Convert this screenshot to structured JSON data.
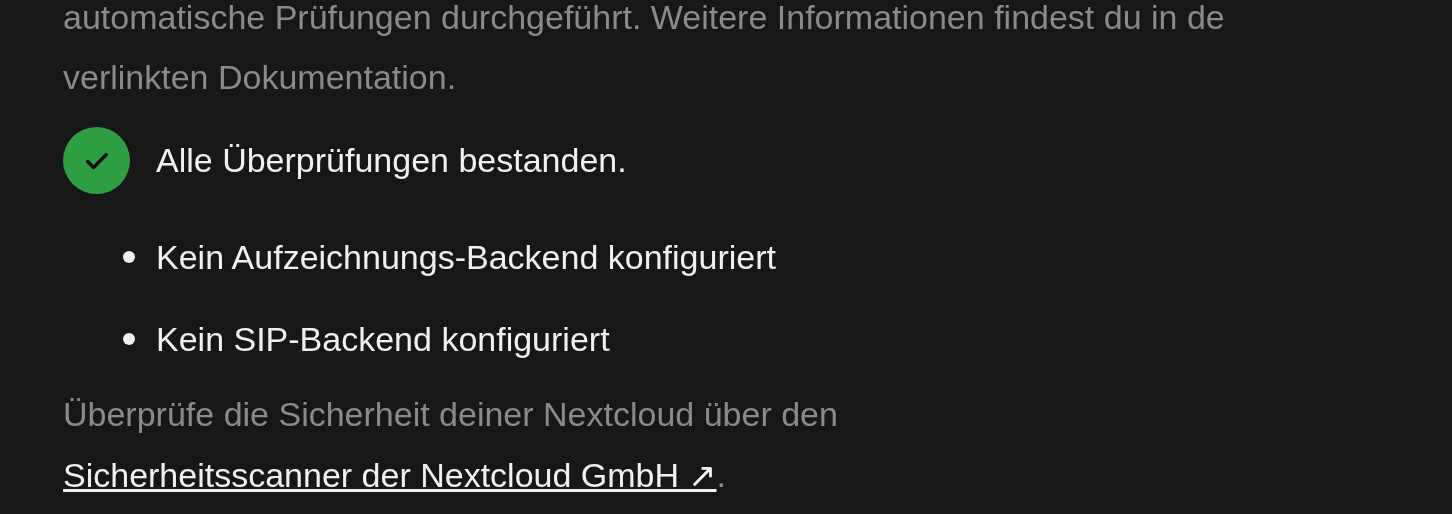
{
  "intro_lines": [
    "automatische Prüfungen durchgeführt. Weitere Informationen findest du in de",
    "verlinkten Dokumentation."
  ],
  "check_result": {
    "passed": true,
    "text": "Alle Überprüfungen bestanden."
  },
  "notes": [
    "Kein Aufzeichnungs-Backend konfiguriert",
    "Kein SIP-Backend konfiguriert"
  ],
  "scanner_hint": {
    "text": "Überprüfe die Sicherheit deiner Nextcloud über den",
    "link": "Sicherheitsscanner der Nextcloud GmbH ↗",
    "suffix": "."
  }
}
